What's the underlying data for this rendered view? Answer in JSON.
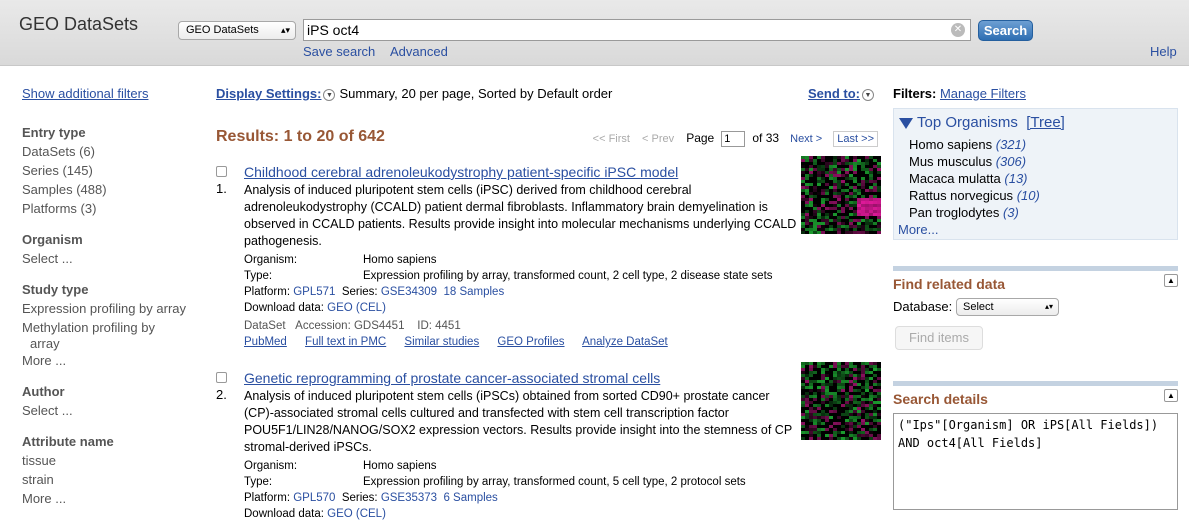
{
  "header": {
    "app_title": "GEO DataSets",
    "db_select_value": "GEO DataSets",
    "search_value": "iPS oct4",
    "search_button": "Search",
    "save_search": "Save search",
    "advanced": "Advanced",
    "help": "Help"
  },
  "left": {
    "show_filters": "Show additional filters",
    "entry_type": {
      "heading": "Entry type",
      "items": [
        "DataSets (6)",
        "Series (145)",
        "Samples (488)",
        "Platforms (3)"
      ]
    },
    "organism": {
      "heading": "Organism",
      "select": "Select ..."
    },
    "study_type": {
      "heading": "Study type",
      "items": [
        "Expression profiling by array",
        "Methylation profiling by",
        "array"
      ],
      "more": "More ..."
    },
    "author": {
      "heading": "Author",
      "select": "Select ..."
    },
    "attribute": {
      "heading": "Attribute name",
      "items": [
        "tissue",
        "strain"
      ],
      "more": "More ..."
    }
  },
  "center": {
    "display_settings_label": "Display Settings:",
    "display_settings_value": "Summary, 20 per page, Sorted by Default order",
    "send_to": "Send to:",
    "results_count": "Results: 1 to 20 of 642",
    "pager": {
      "first": "<< First",
      "prev": "< Prev",
      "page_label": "Page",
      "page_value": "1",
      "of": "of 33",
      "next": "Next >",
      "last": "Last >>"
    },
    "results": [
      {
        "num": "1.",
        "title": "Childhood cerebral adrenoleukodystrophy patient-specific iPSC model",
        "desc": "Analysis of induced pluripotent stem cells (iPSC) derived from childhood cerebral adrenoleukodystrophy (CCALD) patient dermal fibroblasts. Inflammatory brain demyelination is observed in CCALD patients. Results provide insight into molecular mechanisms underlying CCALD pathogenesis.",
        "organism_label": "Organism:",
        "organism": "Homo sapiens",
        "type_label": "Type:",
        "type": "Expression profiling by array, transformed count, 2 cell type, 2 disease state sets",
        "platform_label": "Platform:",
        "platform": "GPL571",
        "series_label": "Series:",
        "series": "GSE34309",
        "samples": "18 Samples",
        "download_label": "Download data:",
        "download": "GEO (CEL)",
        "dataset_label": "DataSet",
        "accession": "Accession: GDS4451",
        "id": "ID: 4451",
        "links": [
          "PubMed",
          "Full text in PMC",
          "Similar studies",
          "GEO Profiles",
          "Analyze DataSet"
        ]
      },
      {
        "num": "2.",
        "title": "Genetic reprogramming of prostate cancer-associated stromal cells",
        "desc": "Analysis of induced pluripotent stem cells (iPSCs) obtained from sorted CD90+ prostate cancer (CP)-associated stromal cells cultured and transfected with stem cell transcription factor POU5F1/LIN28/NANOG/SOX2 expression vectors. Results provide insight into the stemness of CP stromal-derived iPSCs.",
        "organism_label": "Organism:",
        "organism": "Homo sapiens",
        "type_label": "Type:",
        "type": "Expression profiling by array, transformed count, 5 cell type, 2 protocol sets",
        "platform_label": "Platform:",
        "platform": "GPL570",
        "series_label": "Series:",
        "series": "GSE35373",
        "samples": "6 Samples",
        "download_label": "Download data:",
        "download": "GEO (CEL)"
      }
    ]
  },
  "right": {
    "filters_label": "Filters:",
    "manage_filters": "Manage Filters",
    "top_organisms": "Top Organisms",
    "tree": "[Tree]",
    "organisms": [
      {
        "name": "Homo sapiens",
        "count": "(321)"
      },
      {
        "name": "Mus musculus",
        "count": "(306)"
      },
      {
        "name": "Macaca mulatta",
        "count": "(13)"
      },
      {
        "name": "Rattus norvegicus",
        "count": "(10)"
      },
      {
        "name": "Pan troglodytes",
        "count": "(3)"
      }
    ],
    "more": "More...",
    "find_related": "Find related data",
    "database_label": "Database:",
    "database_select": "Select",
    "find_items": "Find items",
    "search_details": "Search details",
    "search_details_text": "(\"Ips\"[Organism] OR iPS[All Fields]) AND oct4[All Fields]"
  },
  "colors": {
    "link": "#2a4fa1",
    "accent_brown": "#985735",
    "search_button": "#2e6eb2",
    "heatmap_green": "#22c33a",
    "heatmap_magenta": "#e0199a"
  }
}
